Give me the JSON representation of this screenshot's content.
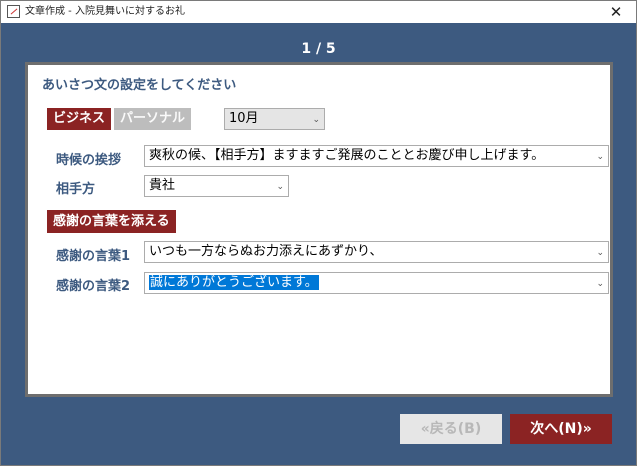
{
  "window": {
    "title": "文章作成 - 入院見舞いに対するお礼",
    "close_glyph": "✕"
  },
  "step": "1 / 5",
  "panel": {
    "heading": "あいさつ文の設定をしてください",
    "tabs": {
      "business": "ビジネス",
      "personal": "パーソナル"
    },
    "month": {
      "value": "10月"
    },
    "seasonal_greeting": {
      "label": "時候の挨拶",
      "value": "爽秋の候、【相手方】ますますご発展のこととお慶び申し上げます。"
    },
    "recipient": {
      "label": "相手方",
      "value": "貴社"
    },
    "gratitude_section": "感謝の言葉を添える",
    "gratitude1": {
      "label": "感謝の言葉1",
      "value": "いつも一方ならぬお力添えにあずかり、"
    },
    "gratitude2": {
      "label": "感謝の言葉2",
      "value": "誠にありがとうございます。"
    }
  },
  "nav": {
    "back": "«戻る(B)",
    "next": "次へ(N)»"
  },
  "icons": {
    "dropdown": "chevron-down-icon",
    "app": "document-edit-icon",
    "close": "close-icon"
  },
  "colors": {
    "background": "#3d5a80",
    "accent": "#8b2323",
    "label": "#3d5a80",
    "selection": "#0078d7"
  }
}
